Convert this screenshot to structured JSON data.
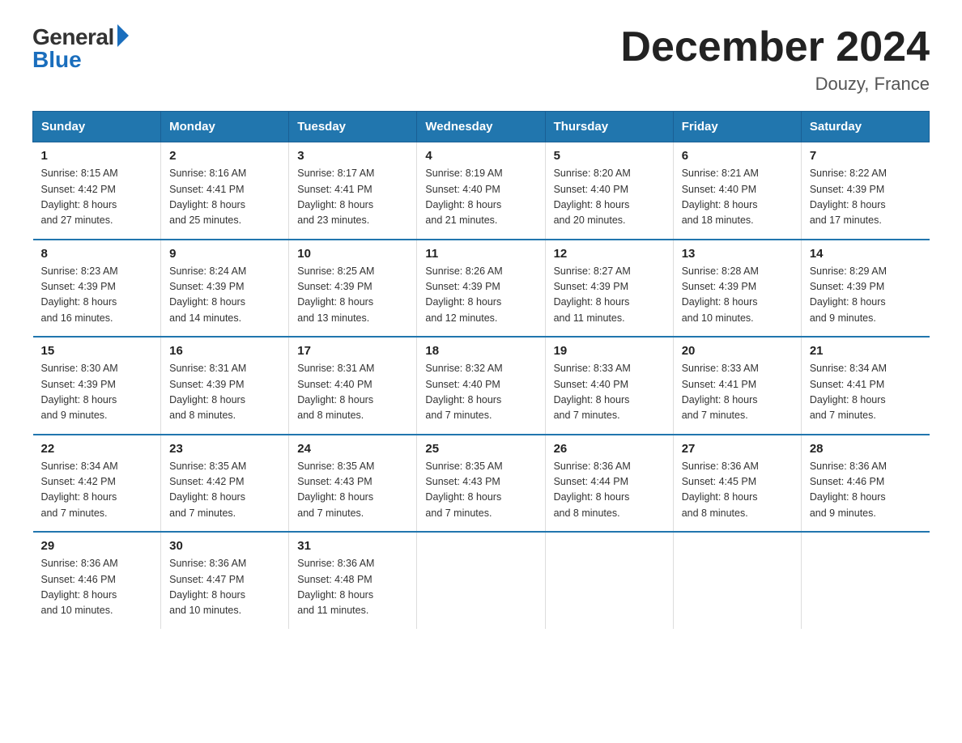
{
  "logo": {
    "general": "General",
    "blue": "Blue"
  },
  "title": "December 2024",
  "location": "Douzy, France",
  "days_of_week": [
    "Sunday",
    "Monday",
    "Tuesday",
    "Wednesday",
    "Thursday",
    "Friday",
    "Saturday"
  ],
  "weeks": [
    [
      {
        "day": "1",
        "sunrise": "8:15 AM",
        "sunset": "4:42 PM",
        "daylight": "8 hours and 27 minutes."
      },
      {
        "day": "2",
        "sunrise": "8:16 AM",
        "sunset": "4:41 PM",
        "daylight": "8 hours and 25 minutes."
      },
      {
        "day": "3",
        "sunrise": "8:17 AM",
        "sunset": "4:41 PM",
        "daylight": "8 hours and 23 minutes."
      },
      {
        "day": "4",
        "sunrise": "8:19 AM",
        "sunset": "4:40 PM",
        "daylight": "8 hours and 21 minutes."
      },
      {
        "day": "5",
        "sunrise": "8:20 AM",
        "sunset": "4:40 PM",
        "daylight": "8 hours and 20 minutes."
      },
      {
        "day": "6",
        "sunrise": "8:21 AM",
        "sunset": "4:40 PM",
        "daylight": "8 hours and 18 minutes."
      },
      {
        "day": "7",
        "sunrise": "8:22 AM",
        "sunset": "4:39 PM",
        "daylight": "8 hours and 17 minutes."
      }
    ],
    [
      {
        "day": "8",
        "sunrise": "8:23 AM",
        "sunset": "4:39 PM",
        "daylight": "8 hours and 16 minutes."
      },
      {
        "day": "9",
        "sunrise": "8:24 AM",
        "sunset": "4:39 PM",
        "daylight": "8 hours and 14 minutes."
      },
      {
        "day": "10",
        "sunrise": "8:25 AM",
        "sunset": "4:39 PM",
        "daylight": "8 hours and 13 minutes."
      },
      {
        "day": "11",
        "sunrise": "8:26 AM",
        "sunset": "4:39 PM",
        "daylight": "8 hours and 12 minutes."
      },
      {
        "day": "12",
        "sunrise": "8:27 AM",
        "sunset": "4:39 PM",
        "daylight": "8 hours and 11 minutes."
      },
      {
        "day": "13",
        "sunrise": "8:28 AM",
        "sunset": "4:39 PM",
        "daylight": "8 hours and 10 minutes."
      },
      {
        "day": "14",
        "sunrise": "8:29 AM",
        "sunset": "4:39 PM",
        "daylight": "8 hours and 9 minutes."
      }
    ],
    [
      {
        "day": "15",
        "sunrise": "8:30 AM",
        "sunset": "4:39 PM",
        "daylight": "8 hours and 9 minutes."
      },
      {
        "day": "16",
        "sunrise": "8:31 AM",
        "sunset": "4:39 PM",
        "daylight": "8 hours and 8 minutes."
      },
      {
        "day": "17",
        "sunrise": "8:31 AM",
        "sunset": "4:40 PM",
        "daylight": "8 hours and 8 minutes."
      },
      {
        "day": "18",
        "sunrise": "8:32 AM",
        "sunset": "4:40 PM",
        "daylight": "8 hours and 7 minutes."
      },
      {
        "day": "19",
        "sunrise": "8:33 AM",
        "sunset": "4:40 PM",
        "daylight": "8 hours and 7 minutes."
      },
      {
        "day": "20",
        "sunrise": "8:33 AM",
        "sunset": "4:41 PM",
        "daylight": "8 hours and 7 minutes."
      },
      {
        "day": "21",
        "sunrise": "8:34 AM",
        "sunset": "4:41 PM",
        "daylight": "8 hours and 7 minutes."
      }
    ],
    [
      {
        "day": "22",
        "sunrise": "8:34 AM",
        "sunset": "4:42 PM",
        "daylight": "8 hours and 7 minutes."
      },
      {
        "day": "23",
        "sunrise": "8:35 AM",
        "sunset": "4:42 PM",
        "daylight": "8 hours and 7 minutes."
      },
      {
        "day": "24",
        "sunrise": "8:35 AM",
        "sunset": "4:43 PM",
        "daylight": "8 hours and 7 minutes."
      },
      {
        "day": "25",
        "sunrise": "8:35 AM",
        "sunset": "4:43 PM",
        "daylight": "8 hours and 7 minutes."
      },
      {
        "day": "26",
        "sunrise": "8:36 AM",
        "sunset": "4:44 PM",
        "daylight": "8 hours and 8 minutes."
      },
      {
        "day": "27",
        "sunrise": "8:36 AM",
        "sunset": "4:45 PM",
        "daylight": "8 hours and 8 minutes."
      },
      {
        "day": "28",
        "sunrise": "8:36 AM",
        "sunset": "4:46 PM",
        "daylight": "8 hours and 9 minutes."
      }
    ],
    [
      {
        "day": "29",
        "sunrise": "8:36 AM",
        "sunset": "4:46 PM",
        "daylight": "8 hours and 10 minutes."
      },
      {
        "day": "30",
        "sunrise": "8:36 AM",
        "sunset": "4:47 PM",
        "daylight": "8 hours and 10 minutes."
      },
      {
        "day": "31",
        "sunrise": "8:36 AM",
        "sunset": "4:48 PM",
        "daylight": "8 hours and 11 minutes."
      },
      null,
      null,
      null,
      null
    ]
  ],
  "labels": {
    "sunrise": "Sunrise:",
    "sunset": "Sunset:",
    "daylight": "Daylight:"
  }
}
